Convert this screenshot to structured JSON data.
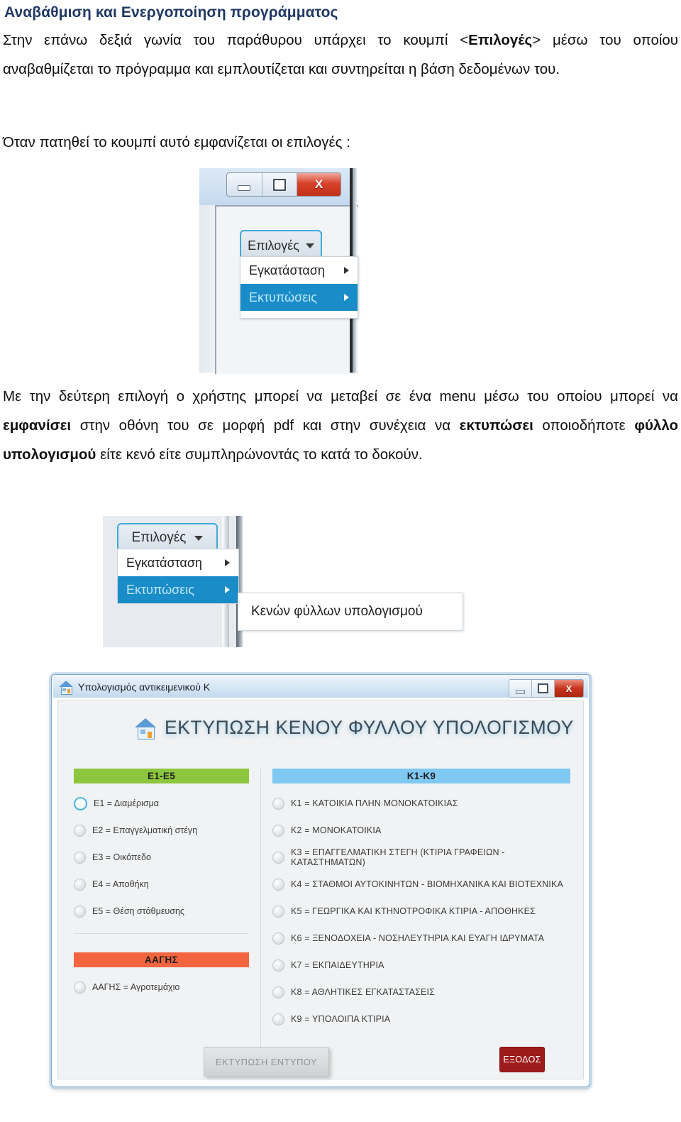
{
  "document": {
    "title": "Αναβάθμιση και Ενεργοποίηση προγράμματος",
    "paragraph1_a": "Στην επάνω δεξιά γωνία του παράθυρου υπάρχει το κουμπί <",
    "paragraph1_bold": "Επιλογές",
    "paragraph1_b": "> μέσω του οποίου αναβαθμίζεται το πρόγραμμα και εμπλουτίζεται και συντηρείται η βάση δεδομένων του.",
    "paragraph2": "Όταν πατηθεί το κουμπί αυτό εμφανίζεται οι επιλογές  :",
    "paragraph3_a": "Με την δεύτερη επιλογή ο χρήστης μπορεί να μεταβεί σε ένα menu μέσω του οποίου μπορεί να ",
    "paragraph3_bold1": "εμφανίσει",
    "paragraph3_b": " στην οθόνη του σε μορφή pdf και στην συνέχεια να ",
    "paragraph3_bold2": "εκτυπώσει",
    "paragraph3_c": " οποιοδήποτε ",
    "paragraph3_bold3": "φύλλο υπολογισμού",
    "paragraph3_d": " είτε κενό είτε συμπληρώνοντάς το κατά το δοκούν."
  },
  "screenshot1": {
    "window_buttons": {
      "minimize": "minimize-icon",
      "maximize": "maximize-icon",
      "close": "X"
    },
    "options_button": "Επιλογές",
    "menu": [
      {
        "label": "Εγκατάσταση",
        "selected": false
      },
      {
        "label": "Εκτυπώσεις",
        "selected": true
      }
    ]
  },
  "screenshot2": {
    "options_button": "Επιλογές",
    "menu": [
      {
        "label": "Εγκατάσταση",
        "selected": false
      },
      {
        "label": "Εκτυπώσεις",
        "selected": true
      }
    ],
    "submenu_item": "Κενών φύλλων υπολογισμού"
  },
  "app_window": {
    "titlebar_text": "Υπολογισμός αντικειμενικού Κ",
    "window_buttons": {
      "minimize": "minimize-icon",
      "maximize": "maximize-icon",
      "close": "X"
    },
    "heading": "ΕΚΤΥΠΩΣΗ ΚΕΝΟΥ ΦΥΛΛΟΥ ΥΠΟΛΟΓΙΣΜΟΥ",
    "left_panel": {
      "bar_label": "Ε1-Ε5",
      "bar_color": "#8cc63e",
      "options": [
        {
          "label": "Ε1 = Διαμέρισμα",
          "selected": true
        },
        {
          "label": "Ε2 = Επαγγελματική στέγη",
          "selected": false
        },
        {
          "label": "Ε3 = Οικόπεδο",
          "selected": false
        },
        {
          "label": "Ε4 = Αποθήκη",
          "selected": false
        },
        {
          "label": "Ε5 = Θέση στάθμευσης",
          "selected": false
        }
      ],
      "bar2_label": "ΑΑΓΗΣ",
      "bar2_color": "#f4653f",
      "options2": [
        {
          "label": "ΑΑΓΗΣ = Αγροτεμάχιο",
          "selected": false
        }
      ]
    },
    "right_panel": {
      "bar_label": "Κ1-Κ9",
      "bar_color": "#7ec8f2",
      "options": [
        {
          "label": "Κ1 = ΚΑΤΟΙΚΙΑ ΠΛΗΝ ΜΟΝΟΚΑΤΟΙΚΙΑΣ",
          "selected": false
        },
        {
          "label": "Κ2 = ΜΟΝΟΚΑΤΟΙΚΙΑ",
          "selected": false
        },
        {
          "label": "Κ3 = ΕΠΑΓΓΕΛΜΑΤΙΚΗ ΣΤΕΓΗ  (ΚΤΙΡΙΑ ΓΡΑΦΕΙΩΝ - ΚΑΤΑΣΤΗΜΑΤΩΝ)",
          "selected": false
        },
        {
          "label": "Κ4 = ΣΤΑΘΜΟΙ ΑΥΤΟΚΙΝΗΤΩΝ - ΒΙΟΜΗΧΑΝΙΚΑ ΚΑΙ ΒΙΟΤΕΧΝΙΚΑ",
          "selected": false
        },
        {
          "label": "Κ5 = ΓΕΩΡΓΙΚΑ ΚΑΙ ΚΤΗΝΟΤΡΟΦΙΚΑ ΚΤΙΡΙΑ - ΑΠΟΘΗΚΕΣ",
          "selected": false
        },
        {
          "label": "Κ6 = ΞΕΝΟΔΟΧΕΙΑ - ΝΟΣΗΛΕΥΤΗΡΙΑ ΚΑΙ ΕΥΑΓΗ ΙΔΡΥΜΑΤΑ",
          "selected": false
        },
        {
          "label": "Κ7 = ΕΚΠΑΙΔΕΥΤΗΡΙΑ",
          "selected": false
        },
        {
          "label": "Κ8 = ΑΘΛΗΤΙΚΕΣ ΕΓΚΑΤΑΣΤΑΣΕΙΣ",
          "selected": false
        },
        {
          "label": "Κ9 = ΥΠΟΛΟΙΠΑ ΚΤΙΡΙΑ",
          "selected": false
        }
      ]
    },
    "print_button": "ΕΚΤΥΠΩΣΗ ΕΝΤΥΠΟΥ",
    "exit_button": "ΕΞΟΔΟΣ"
  }
}
